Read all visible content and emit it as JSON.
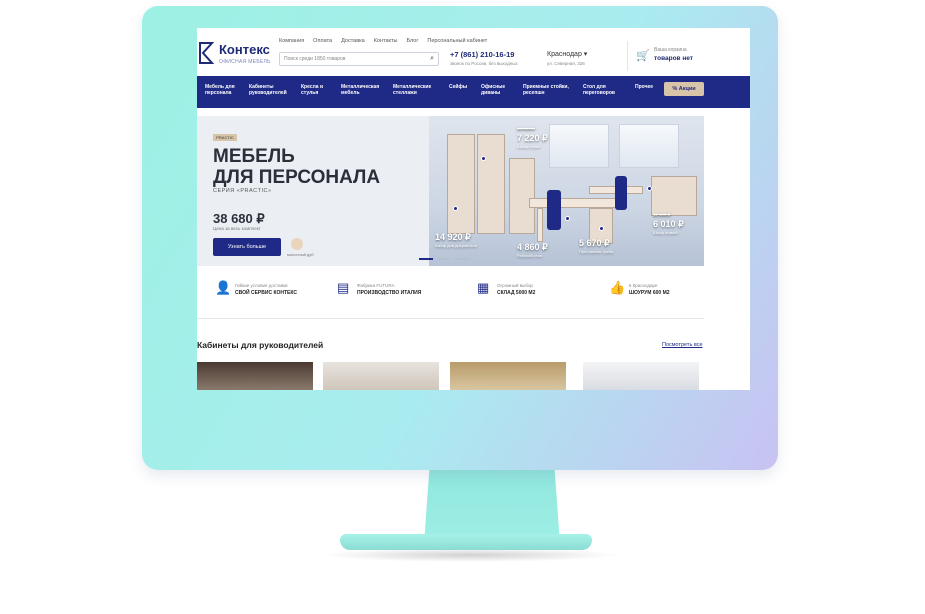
{
  "header": {
    "brand": "Контекс",
    "tagline": "ОФИСНАЯ МЕБЕЛЬ",
    "topnav": [
      "Компания",
      "Оплата",
      "Доставка",
      "Контакты",
      "Блог",
      "Персональный кабинет"
    ],
    "search_placeholder": "Поиск среди 1850 товаров",
    "phone": "+7 (861) 210-16-19",
    "phone_sub": "звонок по России, без выходных",
    "city": "Краснодар ▾",
    "city_sub": "ул. Северная, 326",
    "cart_label": "Ваша корзина",
    "cart_status": "товаров нет"
  },
  "catnav": {
    "items": [
      "Мебель для персонала",
      "Кабинеты руководителей",
      "Кресла и стулья",
      "Металлическая мебель",
      "Металлические стеллажи",
      "Сейфы",
      "Офисные диваны",
      "Приемные стойки, ресепшн",
      "Стол для переговоров",
      "Прочее"
    ],
    "sale_label": "% Акции"
  },
  "hero": {
    "tag": "PRACTIC",
    "title_line1": "МЕБЕЛЬ",
    "title_line2": "ДЛЯ ПЕРСОНАЛА",
    "series": "СЕРИЯ «PRACTIC»",
    "price": "38 680 ₽",
    "price_note": "Цена за весь комплект",
    "cta": "Узнать больше",
    "swatch_label": "молочный дуб",
    "tags": [
      {
        "old": "12 010 ₽",
        "price": "7 220 ₽",
        "cap": "Шкаф-пенал"
      },
      {
        "old": "",
        "price": "14 920 ₽",
        "cap": "Шкаф для документов"
      },
      {
        "old": "",
        "price": "4 860 ₽",
        "cap": "Рабочий стол"
      },
      {
        "old": "",
        "price": "5 670 ₽",
        "cap": "Приставная тумба"
      },
      {
        "old": "11 130 ₽",
        "price": "6 010 ₽",
        "cap": "Шкаф низкий"
      }
    ]
  },
  "features": [
    {
      "a": "Гибкие условия доставки",
      "b": "СВОЙ СЕРВИС КОНТЕКС",
      "icon": "user-icon"
    },
    {
      "a": "Фабрика FUTURA",
      "b": "ПРОИЗВОДСТВО ИТАЛИЯ",
      "icon": "factory-icon"
    },
    {
      "a": "Огромный выбор",
      "b": "СКЛАД 5000 М2",
      "icon": "warehouse-icon"
    },
    {
      "a": "в Краснодаре",
      "b": "ШОУРУМ 600 М2",
      "icon": "thumb-icon"
    }
  ],
  "section": {
    "title": "Кабинеты для руководителей",
    "link": "Посмотреть все"
  }
}
